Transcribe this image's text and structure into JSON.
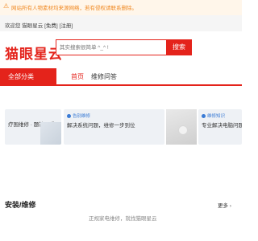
{
  "notice": {
    "icon": "warning-icon",
    "text": "网站所有人物素材均来源网络，若有侵权请联系删除。"
  },
  "topbar": {
    "welcome": "欢迎您 猫眼星云 [免费] [注册]"
  },
  "header": {
    "logo": "猫眼星云",
    "search_placeholder": "其实搜索很简单 ^_^ !",
    "search_button": "搜索"
  },
  "nav": {
    "all_label": "全部分类",
    "tabs": [
      {
        "label": "首页",
        "active": true
      },
      {
        "label": "维修问答",
        "active": false
      }
    ]
  },
  "cards": [
    {
      "caption": "",
      "line": "疗围维修 · 题答回手"
    },
    {
      "caption": "告别维修",
      "line": "解决系统问题，维修一步到位"
    },
    {
      "caption": "维修知识",
      "line": "专业解决电脑问题，教你系统"
    }
  ],
  "section": {
    "title": "安装/维修",
    "more_label": "更多",
    "more_icon": "chevron-right-icon",
    "subtitle": "正规家电维修，就找猫眼星云"
  },
  "colors": {
    "brand": "#e4231b",
    "notice_text": "#f08a24",
    "notice_bg": "#fff6ea",
    "topbar_bg": "#f5f5f5",
    "card_bg": "#eef1f5",
    "card_accent": "#3a7bd5"
  }
}
